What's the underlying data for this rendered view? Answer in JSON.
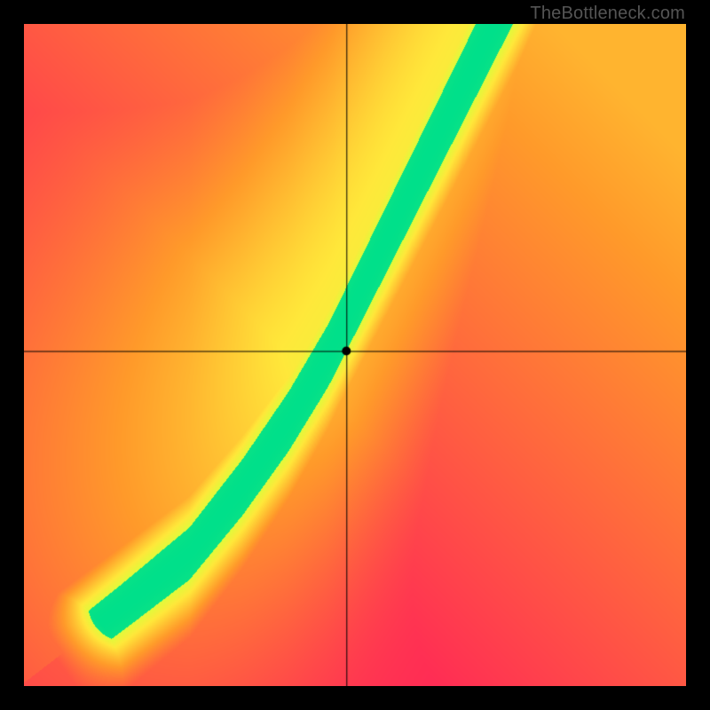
{
  "watermark": "TheBottleneck.com",
  "chart_data": {
    "type": "heatmap",
    "title": "",
    "xlabel": "",
    "ylabel": "",
    "xlim": [
      0,
      1
    ],
    "ylim": [
      0,
      1
    ],
    "crosshair": {
      "x": 0.487,
      "y": 0.506
    },
    "marker": {
      "x": 0.487,
      "y": 0.506
    },
    "colormap": {
      "stops": [
        {
          "t": 0.0,
          "color": "#ff2a55"
        },
        {
          "t": 0.45,
          "color": "#ff9a2a"
        },
        {
          "t": 0.75,
          "color": "#ffe83a"
        },
        {
          "t": 0.92,
          "color": "#d8ff3a"
        },
        {
          "t": 1.0,
          "color": "#00e08a"
        }
      ]
    },
    "ridge_path": {
      "description": "approximate (x,y) of the green optimum band from bottom-left to top-right",
      "points": [
        [
          0.02,
          0.02
        ],
        [
          0.15,
          0.12
        ],
        [
          0.25,
          0.2
        ],
        [
          0.33,
          0.3
        ],
        [
          0.4,
          0.4
        ],
        [
          0.46,
          0.5
        ],
        [
          0.52,
          0.62
        ],
        [
          0.58,
          0.74
        ],
        [
          0.64,
          0.86
        ],
        [
          0.7,
          0.98
        ]
      ]
    },
    "ridge_width": 0.06,
    "asymmetry": {
      "above_ridge_peak": 0.78,
      "below_ridge_peak": 0.55
    }
  }
}
